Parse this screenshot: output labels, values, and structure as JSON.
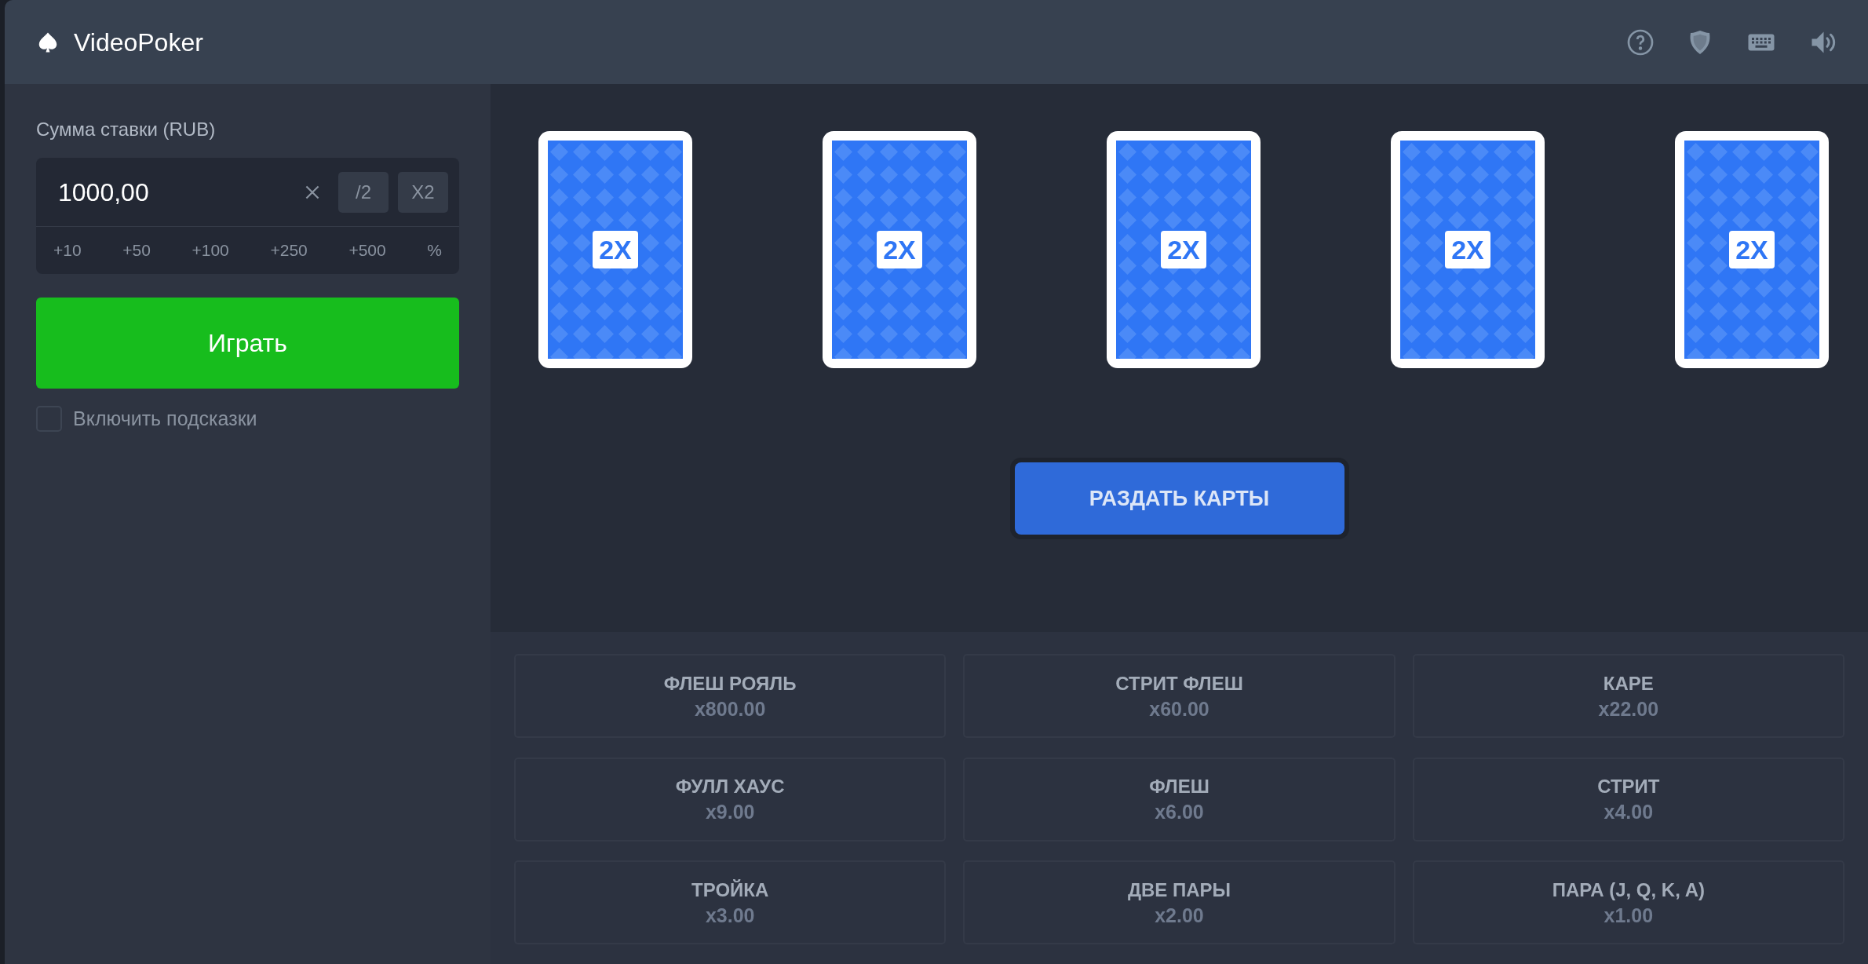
{
  "header": {
    "title": "VideoPoker"
  },
  "bet": {
    "label": "Сумма ставки (RUB)",
    "value": "1000,00",
    "half": "/2",
    "double": "X2",
    "quick": [
      "+10",
      "+50",
      "+100",
      "+250",
      "+500",
      "%"
    ]
  },
  "play_button": "Играть",
  "hints": {
    "label": "Включить подсказки",
    "checked": false
  },
  "cards": [
    {
      "badge": "2X"
    },
    {
      "badge": "2X"
    },
    {
      "badge": "2X"
    },
    {
      "badge": "2X"
    },
    {
      "badge": "2X"
    }
  ],
  "deal_button": "РАЗДАТЬ КАРТЫ",
  "paytable": [
    {
      "hand": "ФЛЕШ РОЯЛЬ",
      "multiplier": "x800.00"
    },
    {
      "hand": "СТРИТ ФЛЕШ",
      "multiplier": "x60.00"
    },
    {
      "hand": "КАРЕ",
      "multiplier": "x22.00"
    },
    {
      "hand": "ФУЛЛ ХАУС",
      "multiplier": "x9.00"
    },
    {
      "hand": "ФЛЕШ",
      "multiplier": "x6.00"
    },
    {
      "hand": "СТРИТ",
      "multiplier": "x4.00"
    },
    {
      "hand": "ТРОЙКА",
      "multiplier": "x3.00"
    },
    {
      "hand": "ДВЕ ПАРЫ",
      "multiplier": "x2.00"
    },
    {
      "hand": "ПАРА (J, Q, K, A)",
      "multiplier": "x1.00"
    }
  ]
}
